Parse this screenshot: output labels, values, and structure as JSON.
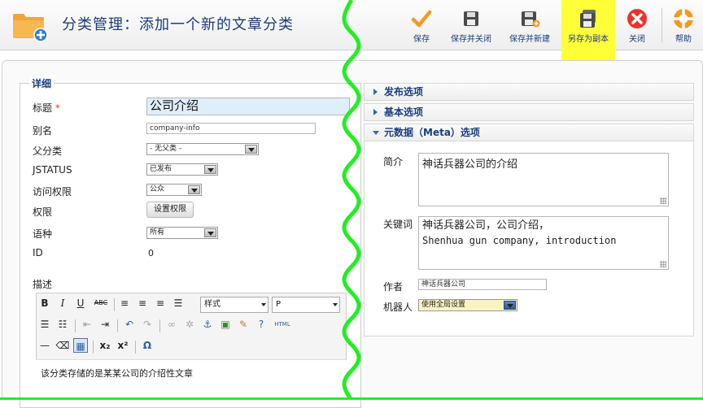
{
  "header": {
    "title": "分类管理：添加一个新的文章分类",
    "toolbar": [
      {
        "label": "保存",
        "icon": "check-icon"
      },
      {
        "label": "保存并关闭",
        "icon": "save-close-icon"
      },
      {
        "label": "保存并新建",
        "icon": "save-new-icon"
      },
      {
        "label": "另存为副本",
        "icon": "save-copy-icon"
      },
      {
        "label": "关闭",
        "icon": "close-icon"
      },
      {
        "label": "帮助",
        "icon": "help-icon"
      }
    ]
  },
  "details": {
    "legend": "详细",
    "title_label": "标题",
    "required_mark": "*",
    "title_value": "公司介绍",
    "alias_label": "别名",
    "alias_value": "company-info",
    "parent_label": "父分类",
    "parent_value": "- 无父类 -",
    "status_label": "JSTATUS",
    "status_value": "已发布",
    "access_label": "访问权限",
    "access_value": "公众",
    "permissions_label": "权限",
    "permissions_button": "设置权限",
    "language_label": "语种",
    "language_value": "所有",
    "id_label": "ID",
    "id_value": "0",
    "desc_label": "描述"
  },
  "editor": {
    "style_dropdown": "样式",
    "format_dropdown": "P",
    "html_label": "HTML",
    "content": "该分类存储的是某某公司的介绍性文章"
  },
  "panels": {
    "publish": "发布选项",
    "basic": "基本选项",
    "meta": "元数据（Meta）选项"
  },
  "meta": {
    "desc_label": "简介",
    "desc_value": "神话兵器公司的介绍",
    "keywords_label": "关键词",
    "keywords_line1": "神话兵器公司，公司介绍，",
    "keywords_line2": "Shenhua gun company, introduction",
    "author_label": "作者",
    "author_value": "神话兵器公司",
    "robots_label": "机器人",
    "robots_value": "使用全局设置"
  }
}
